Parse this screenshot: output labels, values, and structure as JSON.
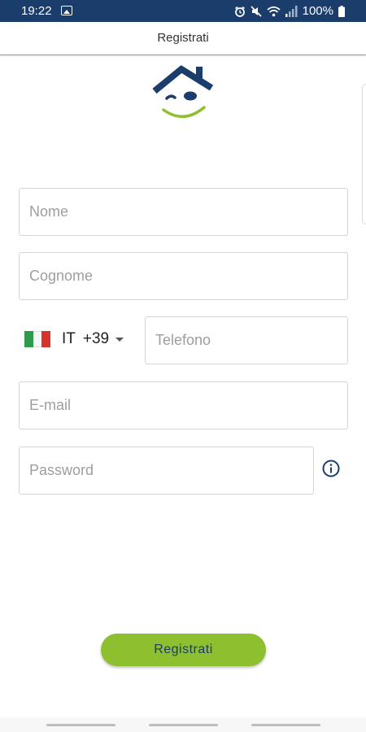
{
  "status_bar": {
    "time": "19:22",
    "battery": "100%",
    "icons": [
      "image-icon",
      "alarm-icon",
      "mute-icon",
      "wifi-icon",
      "signal-icon",
      "battery-icon"
    ]
  },
  "app_bar": {
    "title": "Registrati"
  },
  "form": {
    "nome_placeholder": "Nome",
    "cognome_placeholder": "Cognome",
    "country_code": "IT",
    "dial_code": "+39",
    "telefono_placeholder": "Telefono",
    "email_placeholder": "E-mail",
    "password_placeholder": "Password"
  },
  "register_button": {
    "label": "Registrati"
  },
  "colors": {
    "status_bar": "#1b3d6b",
    "primary_navy": "#1b3d6b",
    "accent_green": "#8dbf2f",
    "field_border": "#d4d4d4",
    "placeholder": "#9e9e9e"
  }
}
